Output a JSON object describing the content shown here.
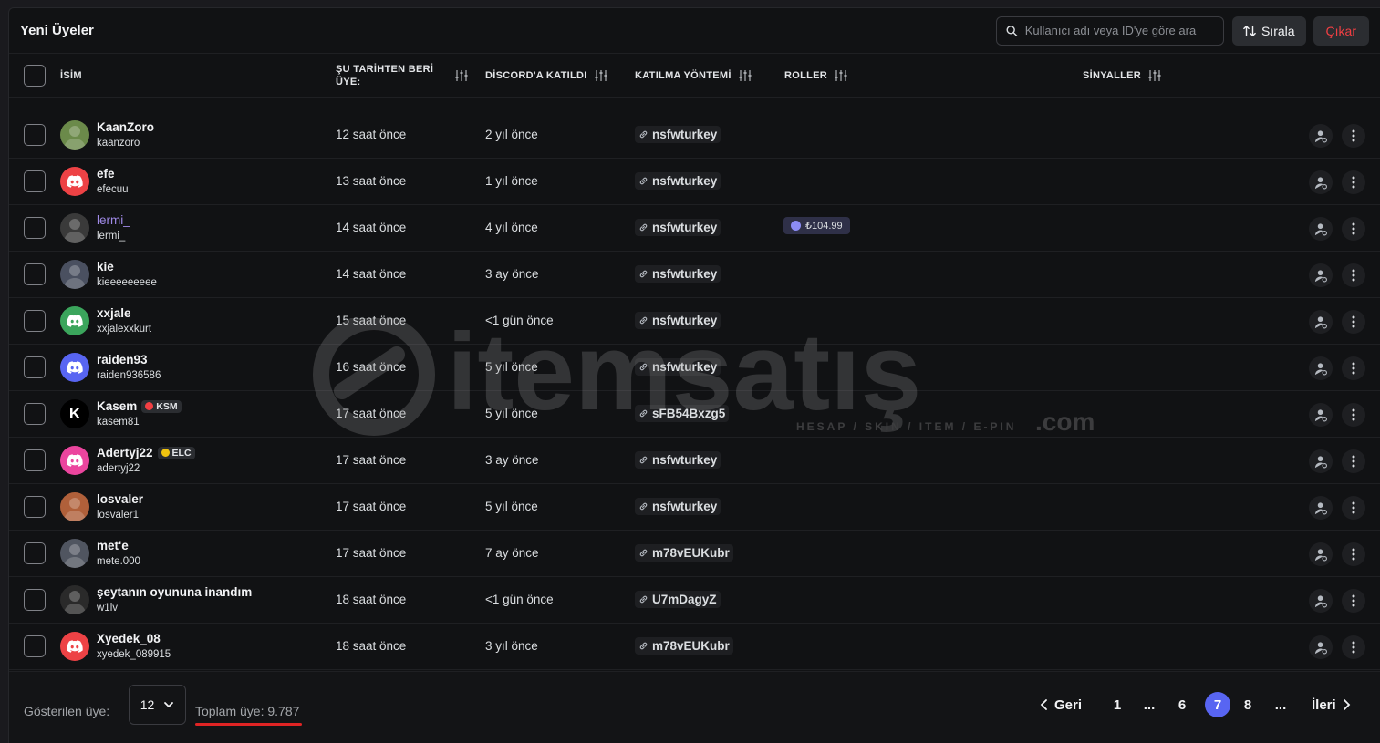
{
  "header": {
    "title": "Yeni Üyeler",
    "search_placeholder": "Kullanıcı adı veya ID'ye göre ara",
    "sort_label": "Sırala",
    "kick_label": "Çıkar"
  },
  "columns": {
    "name": "İSİM",
    "member_since": "ŞU TARİHTEN BERİ ÜYE:",
    "joined_discord": "DİSCORD'A KATILDI",
    "join_method": "KATILMA YÖNTEMİ",
    "roles": "ROLLER",
    "signals": "SİNYALLER"
  },
  "members": [
    {
      "name": "KaanZoro",
      "handle": "kaanzoro",
      "since": "12 saat önce",
      "joined": "2 yıl önce",
      "invite": "nsfwturkey",
      "avatar": "photo",
      "avatar_color": "#6b8a4a"
    },
    {
      "name": "efe",
      "handle": "efecuu",
      "since": "13 saat önce",
      "joined": "1 yıl önce",
      "invite": "nsfwturkey",
      "avatar": "discord",
      "avatar_color": "#ed4245"
    },
    {
      "name": "lermi_",
      "handle": "lermi_",
      "since": "14 saat önce",
      "joined": "4 yıl önce",
      "invite": "nsfwturkey",
      "avatar": "photo",
      "avatar_color": "#3a3a3a",
      "role": "₺104.99"
    },
    {
      "name": "kie",
      "handle": "kieeeeeeeee",
      "since": "14 saat önce",
      "joined": "3 ay önce",
      "invite": "nsfwturkey",
      "avatar": "photo",
      "avatar_color": "#4a5060"
    },
    {
      "name": "xxjale",
      "handle": "xxjalexxkurt",
      "since": "15 saat önce",
      "joined": "<1 gün önce",
      "invite": "nsfwturkey",
      "avatar": "discord",
      "avatar_color": "#3ba55c"
    },
    {
      "name": "raiden93",
      "handle": "raiden936586",
      "since": "16 saat önce",
      "joined": "5 yıl önce",
      "invite": "nsfwturkey",
      "avatar": "discord",
      "avatar_color": "#5865f2"
    },
    {
      "name": "Kasem",
      "handle": "kasem81",
      "since": "17 saat önce",
      "joined": "5 yıl önce",
      "invite": "sFB54Bxzg5",
      "avatar": "letter",
      "avatar_letter": "K",
      "avatar_color": "#000000",
      "tag": "KSM"
    },
    {
      "name": "Adertyj22",
      "handle": "adertyj22",
      "since": "17 saat önce",
      "joined": "3 ay önce",
      "invite": "nsfwturkey",
      "avatar": "discord",
      "avatar_color": "#eb459e",
      "tag": "ELC"
    },
    {
      "name": "losvaler",
      "handle": "losvaler1",
      "since": "17 saat önce",
      "joined": "5 yıl önce",
      "invite": "nsfwturkey",
      "avatar": "photo",
      "avatar_color": "#b0603a"
    },
    {
      "name": "met'e",
      "handle": "mete.000",
      "since": "17 saat önce",
      "joined": "7 ay önce",
      "invite": "m78vEUKubr",
      "avatar": "photo",
      "avatar_color": "#505560"
    },
    {
      "name": "şeytanın oyununa inandım",
      "handle": "w1lv",
      "since": "18 saat önce",
      "joined": "<1 gün önce",
      "invite": "U7mDagyZ",
      "avatar": "photo",
      "avatar_color": "#2a2a2a"
    },
    {
      "name": "Xyedek_08",
      "handle": "xyedek_089915",
      "since": "18 saat önce",
      "joined": "3 yıl önce",
      "invite": "m78vEUKubr",
      "avatar": "discord",
      "avatar_color": "#ed4245"
    }
  ],
  "footer": {
    "shown_label": "Gösterilen üye:",
    "page_size": "12",
    "total": "Toplam üye: 9.787"
  },
  "pagination": {
    "prev": "Geri",
    "next": "İleri",
    "pages": [
      "1",
      "...",
      "6",
      "7",
      "8",
      "..."
    ],
    "current": "7"
  },
  "watermark": {
    "brand": "itemsatış",
    "tagline": "HESAP / SKIN / ITEM / E-PIN",
    "suffix": ".com"
  },
  "colors": {
    "accent": "#5865f2",
    "danger": "#f23f43",
    "background": "#111214"
  }
}
